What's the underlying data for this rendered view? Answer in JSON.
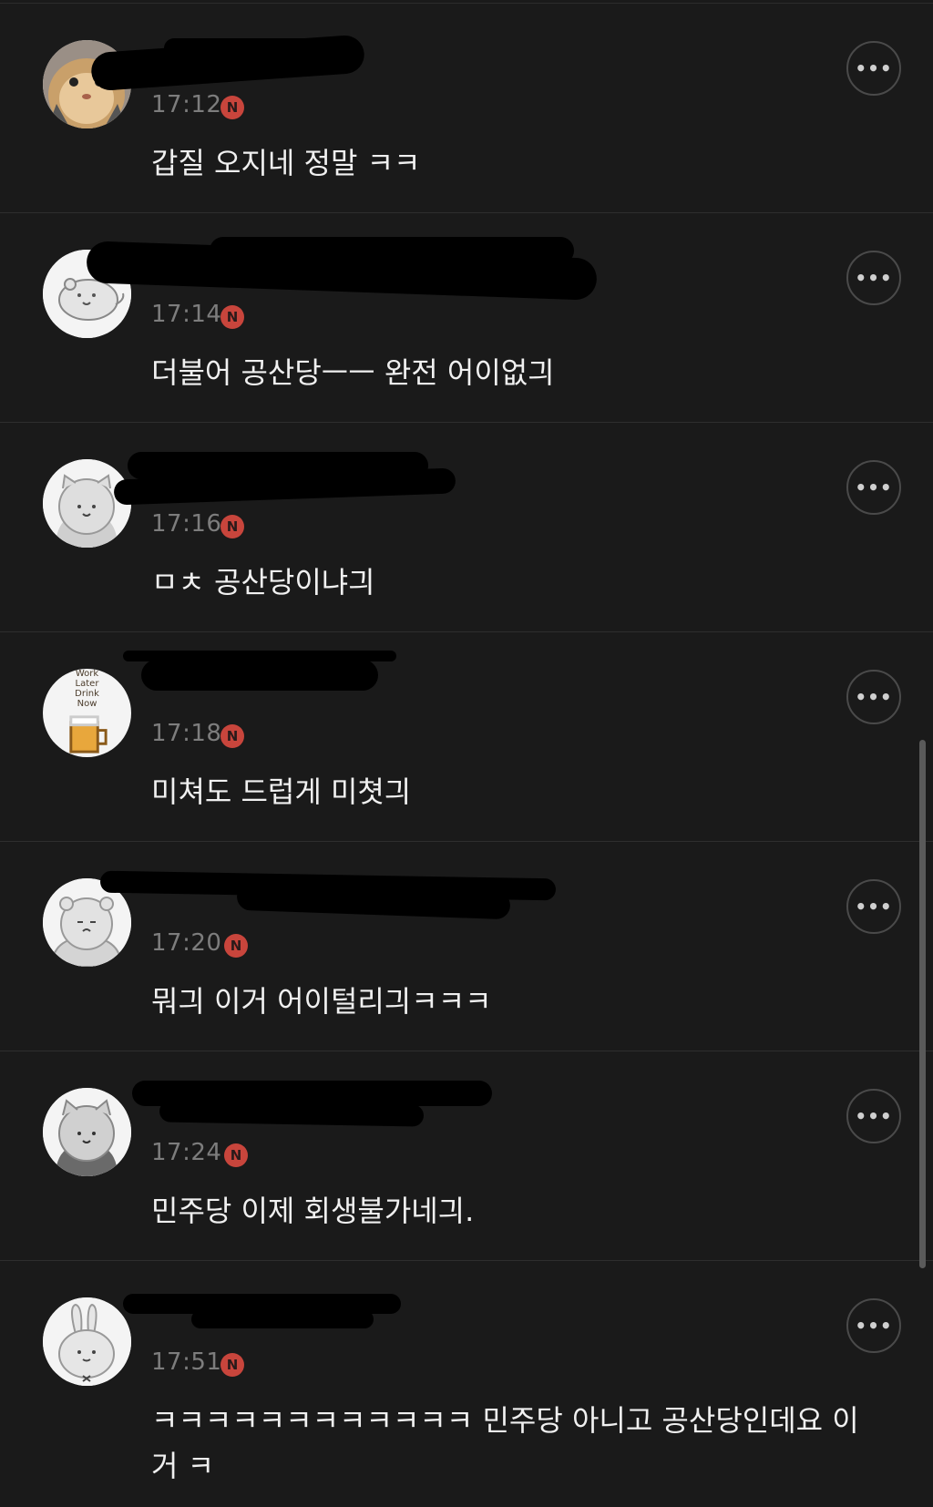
{
  "comments": [
    {
      "time": "17:12",
      "badge": "N",
      "text": "갑질 오지네 정말 ㅋㅋ",
      "avatar_icon": "cat-photo-avatar"
    },
    {
      "time": "17:14",
      "badge": "N",
      "text": "더불어 공산당ㅡㅡ 완전 어이없긔",
      "avatar_icon": "hamster-sketch-avatar"
    },
    {
      "time": "17:16",
      "badge": "N",
      "text": "ㅁㅊ 공산당이냐긔",
      "avatar_icon": "bear-sketch-avatar"
    },
    {
      "time": "17:18",
      "badge": "N",
      "text": "미쳐도 드럽게 미쳣긔",
      "avatar_icon": "work-later-drink-now-avatar",
      "avatar_text": [
        "Work",
        "Later",
        "Drink",
        "Now"
      ]
    },
    {
      "time": "17:20",
      "badge": "N",
      "text": "뭐긔 이거 어이털리긔ㅋㅋㅋ",
      "avatar_icon": "sleepy-bear-sketch-avatar"
    },
    {
      "time": "17:24",
      "badge": "N",
      "text": "민주당 이제 회생불가네긔.",
      "avatar_icon": "cat-sketch-avatar"
    },
    {
      "time": "17:51",
      "badge": "N",
      "text": "ㅋㅋㅋㅋㅋㅋㅋㅋㅋㅋㅋㅋ 민주당 아니고 공산당인데요 이거 ㅋ",
      "avatar_icon": "rabbit-sketch-avatar"
    }
  ],
  "more_icon": "more-dots-icon",
  "colors": {
    "background": "#1a1a1a",
    "badge": "#c8453c",
    "divider": "#2e2e2e",
    "text": "#f0f0f0",
    "meta": "#7d7d7d"
  }
}
